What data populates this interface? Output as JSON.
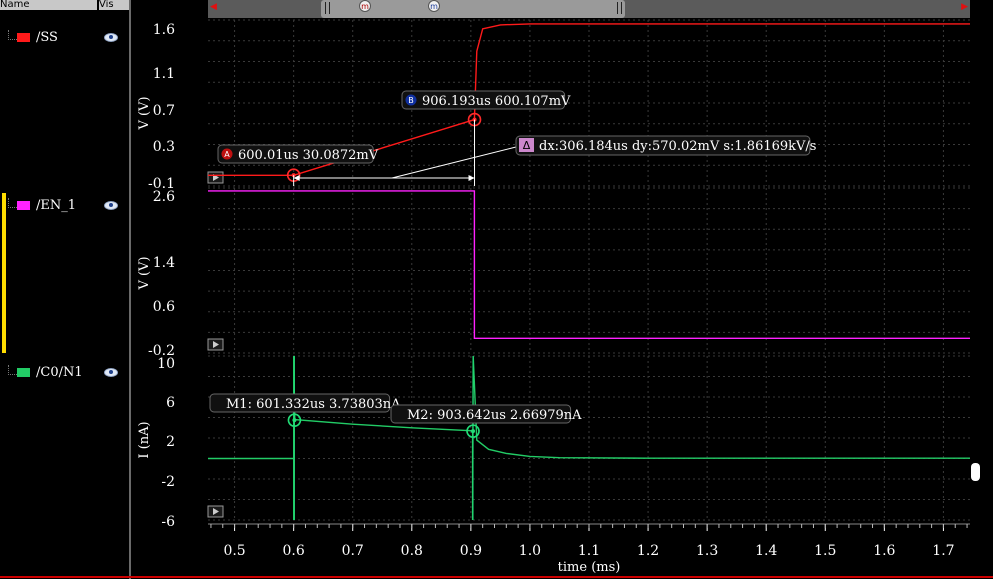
{
  "header": {
    "name_col": "Name",
    "vis_col": "Vis"
  },
  "signals": [
    {
      "label": "/SS",
      "color": "#ff1a1a"
    },
    {
      "label": "/EN_1",
      "color": "#ff22ff"
    },
    {
      "label": "/C0/N1",
      "color": "#22cc66"
    }
  ],
  "icons": {
    "visibility": "eye-icon",
    "expand": "expand-arrow-icon"
  },
  "scrollbar": {
    "left_arrow": "◀",
    "right_arrow": "▶",
    "markers": [
      "m",
      "m"
    ]
  },
  "x_axis": {
    "label": "time (ms)",
    "ticks": [
      "0.5",
      "0.6",
      "0.7",
      "0.8",
      "0.9",
      "1.0",
      "1.1",
      "1.2",
      "1.3",
      "1.4",
      "1.5",
      "1.6",
      "1.7"
    ],
    "range": [
      0.455,
      1.745
    ]
  },
  "chart_data": [
    {
      "type": "line",
      "ylabel": "V (V)",
      "yticks": [
        "1.6",
        "1.1",
        "0.7",
        "0.3",
        "-0.1"
      ],
      "ylim": [
        -0.08,
        1.62
      ],
      "grid": true,
      "series": [
        {
          "name": "/SS",
          "color": "#ff1a1a",
          "x": [
            0.455,
            0.6,
            0.6,
            0.906,
            0.906,
            0.91,
            0.92,
            0.95,
            1.0,
            1.2,
            1.745
          ],
          "y": [
            0.03,
            0.03,
            0.03,
            0.6,
            0.6,
            1.3,
            1.53,
            1.57,
            1.58,
            1.58,
            1.58
          ]
        }
      ],
      "markers": [
        {
          "id": "A",
          "x": 0.60001,
          "y": 0.030872,
          "label": "600.01us 30.0872mV"
        },
        {
          "id": "B",
          "x": 0.906193,
          "y": 0.600107,
          "label": "906.193us 600.107mV"
        }
      ],
      "delta": {
        "label": "dx:306.184us dy:570.02mV s:1.86169kV/s"
      }
    },
    {
      "type": "line",
      "ylabel": "V (V)",
      "yticks": [
        "2.6",
        "1.4",
        "0.6",
        "-0.2"
      ],
      "ylim": [
        -0.25,
        2.55
      ],
      "grid": true,
      "series": [
        {
          "name": "/EN_1",
          "color": "#ff22ff",
          "x": [
            0.455,
            0.906,
            0.906,
            1.745
          ],
          "y": [
            2.5,
            2.5,
            0.0,
            0.0
          ]
        }
      ]
    },
    {
      "type": "line",
      "ylabel": "I (nA)",
      "yticks": [
        "10",
        "6",
        "2",
        "-2",
        "-6"
      ],
      "ylim": [
        -6,
        10
      ],
      "grid": true,
      "series": [
        {
          "name": "/C0/N1",
          "color": "#22cc66",
          "x": [
            0.455,
            0.6,
            0.6,
            0.6,
            0.602,
            0.7,
            0.8,
            0.903,
            0.903,
            0.904,
            0.91,
            0.93,
            0.96,
            1.0,
            1.05,
            1.2,
            1.745
          ],
          "y": [
            0,
            0,
            -6,
            10,
            3.8,
            3.35,
            3.0,
            2.7,
            -6,
            10,
            1.8,
            0.9,
            0.5,
            0.2,
            0.08,
            0.03,
            0.03
          ]
        }
      ],
      "markers": [
        {
          "id": "M1",
          "x": 0.601332,
          "y": 3.73803,
          "label": "M1: 601.332us 3.73803nA"
        },
        {
          "id": "M2",
          "x": 0.903642,
          "y": 2.66979,
          "label": "M2: 903.642us 2.66979nA"
        }
      ]
    }
  ]
}
